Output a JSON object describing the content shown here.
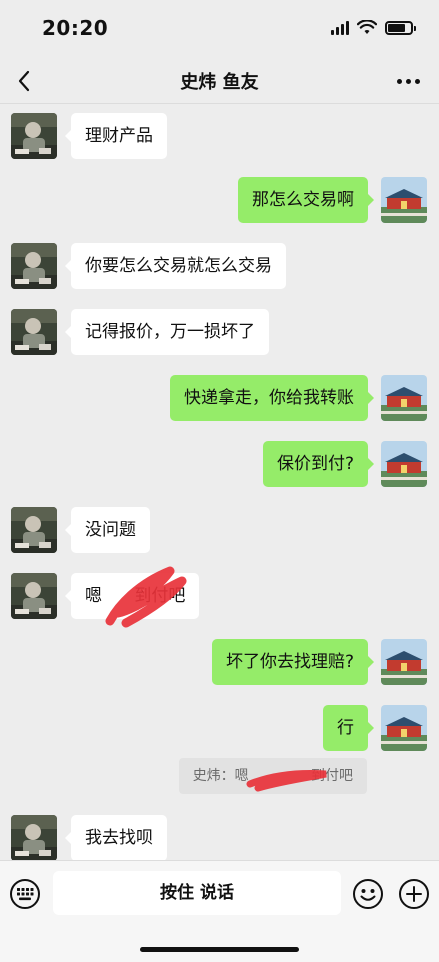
{
  "status_bar": {
    "time": "20:20",
    "battery_level": 0.75
  },
  "nav": {
    "title": "史炜 鱼友"
  },
  "messages": [
    {
      "side": "left",
      "text": "理财产品"
    },
    {
      "side": "right",
      "text": "那怎么交易啊"
    },
    {
      "side": "left",
      "text": "你要怎么交易就怎么交易"
    },
    {
      "side": "left",
      "text": "记得报价，万一损坏了"
    },
    {
      "side": "right",
      "text": "快递拿走，你给我转账"
    },
    {
      "side": "right",
      "text": "保价到付?"
    },
    {
      "side": "left",
      "text": "没问题"
    },
    {
      "side": "left",
      "text": "嗯      到付吧"
    },
    {
      "side": "right",
      "text": "坏了你去找理赔?"
    },
    {
      "side": "right",
      "text": "行"
    },
    {
      "side": "left",
      "text": "我去找呗"
    }
  ],
  "quote": {
    "text": "史炜：嗯              到付吧"
  },
  "input_bar": {
    "hold_to_talk": "按住 说话"
  },
  "colors": {
    "self_bubble": "#95ec69",
    "peer_bubble": "#ffffff",
    "background": "#ededed",
    "scribble": "#e8323a"
  },
  "icons": [
    "back-icon",
    "more-icon",
    "keyboard-icon",
    "emoji-icon",
    "plus-icon",
    "signal-icon",
    "wifi-icon",
    "battery-icon"
  ]
}
